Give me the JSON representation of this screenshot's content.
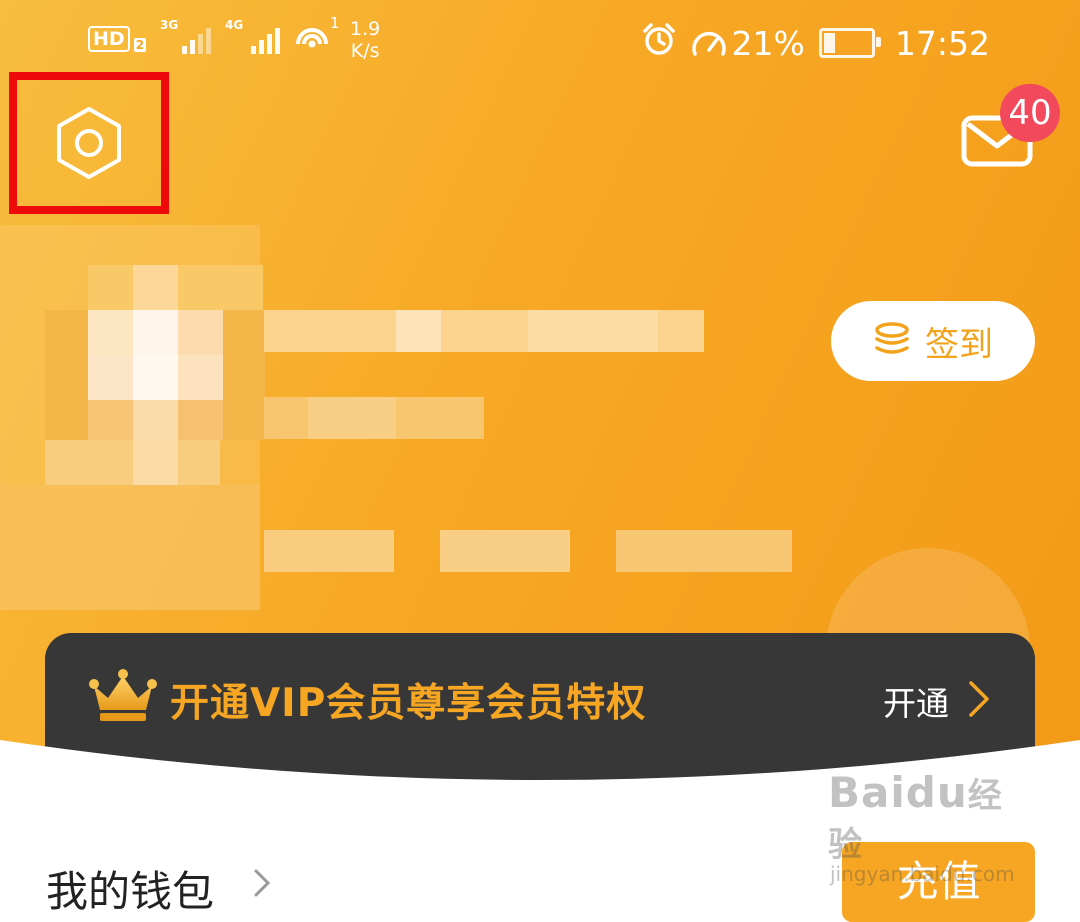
{
  "status_bar": {
    "hd": "HD",
    "hd_sub": "2",
    "net1": "3G",
    "net2": "4G",
    "wifi_sup": "1",
    "speed_value": "1.9",
    "speed_unit": "K/s",
    "perf": "21%",
    "time": "17:52"
  },
  "header": {
    "settings_icon": "hexagon-gear-icon",
    "mail_icon": "envelope-icon",
    "mail_badge": "40",
    "signin_label": "签到",
    "signin_icon": "coin-stack-icon"
  },
  "vip": {
    "title": "开通VIP会员尊享会员特权",
    "action": "开通",
    "crown_icon": "crown-icon"
  },
  "wallet": {
    "title": "我的钱包",
    "action": "充值"
  },
  "watermark": {
    "logo": "Bai",
    "logo2": "du",
    "logo3": "经验",
    "url": "jingyan.baidu.com"
  },
  "colors": {
    "accent": "#f6a623",
    "vip_bar": "#373737",
    "badge": "#f24a5c",
    "highlight_box": "#ee0a0a"
  }
}
